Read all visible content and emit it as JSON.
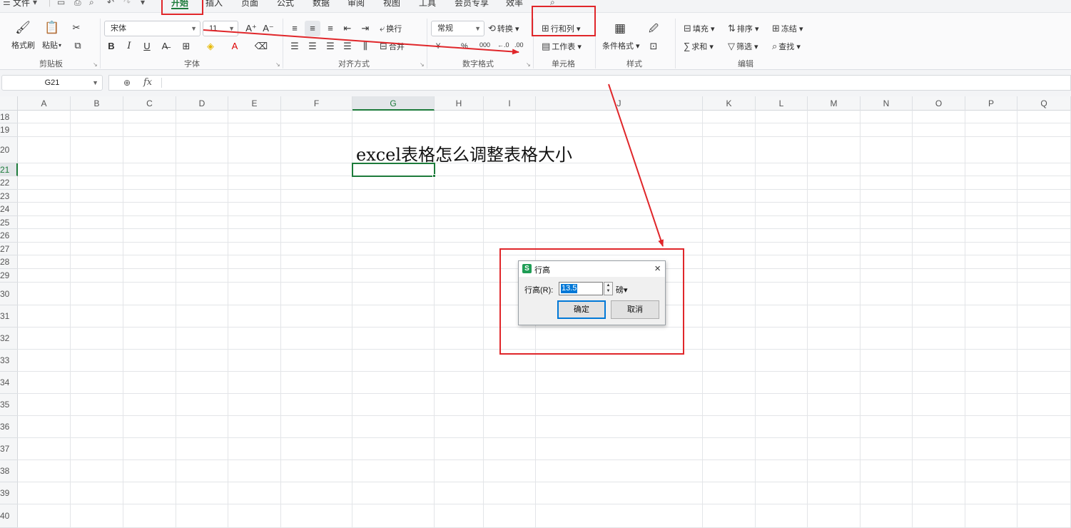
{
  "menubar": {
    "file_label": "文件",
    "tabs": [
      {
        "label": "开始",
        "active": true
      },
      {
        "label": "插入"
      },
      {
        "label": "页面"
      },
      {
        "label": "公式"
      },
      {
        "label": "数据"
      },
      {
        "label": "审阅"
      },
      {
        "label": "视图"
      },
      {
        "label": "工具"
      },
      {
        "label": "会员专享"
      },
      {
        "label": "效率"
      }
    ]
  },
  "ribbon": {
    "clipboard": {
      "format_painter": "格式刷",
      "paste": "粘贴",
      "group": "剪贴板"
    },
    "font": {
      "name": "宋体",
      "size": "11",
      "group": "字体",
      "bold": "B",
      "italic": "I",
      "underline": "U"
    },
    "align": {
      "wrap": "换行",
      "merge": "合并",
      "group": "对齐方式"
    },
    "number": {
      "format": "常规",
      "convert": "转换",
      "currency": "¥",
      "percent": "%",
      "thousands": "000",
      "group": "数字格式"
    },
    "cells": {
      "rows_cols": "行和列",
      "worksheet": "工作表",
      "group": "单元格"
    },
    "styles": {
      "conditional": "条件格式",
      "group": "样式"
    },
    "editing": {
      "fill": "填充",
      "sort": "排序",
      "freeze": "冻结",
      "sum": "求和",
      "filter": "筛选",
      "find": "查找",
      "group": "编辑"
    }
  },
  "formula_bar": {
    "cell_ref": "G21",
    "fx": "fx",
    "content": ""
  },
  "columns": [
    "A",
    "B",
    "C",
    "D",
    "E",
    "F",
    "G",
    "H",
    "I",
    "J",
    "K",
    "L",
    "M",
    "N",
    "O",
    "P",
    "Q"
  ],
  "selected_column": "G",
  "rows": [
    "18",
    "19",
    "20",
    "21",
    "22",
    "23",
    "24",
    "25",
    "26",
    "27",
    "28",
    "29",
    "30",
    "31",
    "32",
    "33",
    "34",
    "35",
    "36",
    "37",
    "38",
    "39",
    "40"
  ],
  "selected_row": "21",
  "cell_text": "excel表格怎么调整表格大小",
  "dialog": {
    "logo": "S",
    "title": "行高",
    "label": "行高(R):",
    "value": "13.5",
    "unit": "磅",
    "ok": "确定",
    "cancel": "取消",
    "close": "×"
  },
  "colors": {
    "accent": "#1d7b3b",
    "annotation": "#e0262a",
    "selection": "#0078d7"
  }
}
